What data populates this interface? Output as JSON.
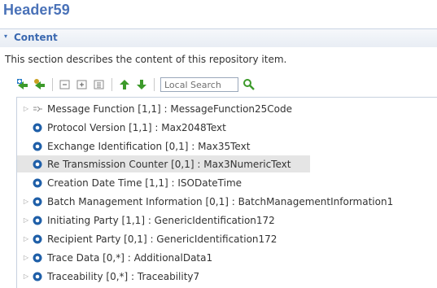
{
  "page": {
    "title": "Header59"
  },
  "section": {
    "toggle_glyph": "▾",
    "title": "Content",
    "description": "This section describes the content of this repository item."
  },
  "toolbar": {
    "buttons": [
      {
        "icon": "add-element-icon"
      },
      {
        "icon": "add-attribute-icon"
      },
      {
        "icon": "collapse-all-icon"
      },
      {
        "icon": "expand-all-icon"
      },
      {
        "icon": "expand-level-icon"
      },
      {
        "icon": "move-up-icon"
      },
      {
        "icon": "move-down-icon"
      },
      {
        "icon": "search-go-icon"
      }
    ],
    "search_placeholder": "Local Search"
  },
  "tree": {
    "items": [
      {
        "label": "Message Function [1,1] : MessageFunction25Code",
        "icon": "code-list-icon",
        "expandable": true,
        "selected": false
      },
      {
        "label": "Protocol Version [1,1] : Max2048Text",
        "icon": "element-icon",
        "expandable": false,
        "selected": false
      },
      {
        "label": "Exchange Identification [0,1] : Max35Text",
        "icon": "element-icon",
        "expandable": false,
        "selected": false
      },
      {
        "label": "Re Transmission Counter [0,1] : Max3NumericText",
        "icon": "element-icon",
        "expandable": false,
        "selected": true
      },
      {
        "label": "Creation Date Time [1,1] : ISODateTime",
        "icon": "element-icon",
        "expandable": false,
        "selected": false
      },
      {
        "label": "Batch Management Information [0,1] : BatchManagementInformation1",
        "icon": "element-icon",
        "expandable": true,
        "selected": false
      },
      {
        "label": "Initiating Party [1,1] : GenericIdentification172",
        "icon": "element-icon",
        "expandable": true,
        "selected": false
      },
      {
        "label": "Recipient Party [0,1] : GenericIdentification172",
        "icon": "element-icon",
        "expandable": true,
        "selected": false
      },
      {
        "label": "Trace Data [0,*] : AdditionalData1",
        "icon": "element-icon",
        "expandable": true,
        "selected": false
      },
      {
        "label": "Traceability [0,*] : Traceability7",
        "icon": "element-icon",
        "expandable": true,
        "selected": false
      }
    ]
  },
  "colors": {
    "title": "#4a72b8",
    "element_icon": "#1f5fa8",
    "selected_row": "#e5e5e5",
    "arrow_green": "#3c9a2a"
  }
}
